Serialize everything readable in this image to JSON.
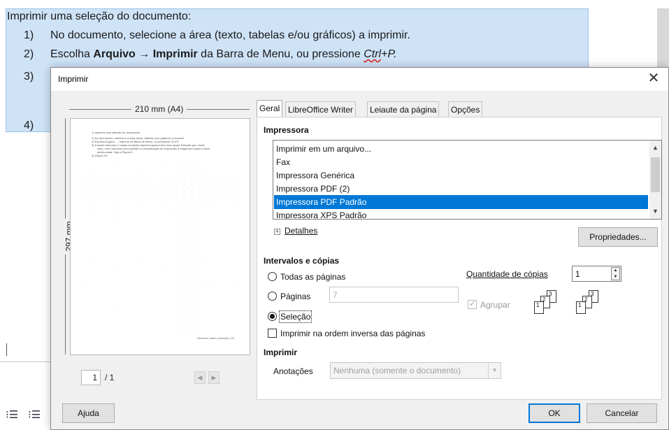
{
  "document": {
    "heading": "Imprimir uma seleção do documento:",
    "steps": [
      {
        "num": "1)",
        "text": "No documento, selecione a área (texto, tabelas e/ou gráficos) a imprimir."
      },
      {
        "num": "2)",
        "pre": "Escolha ",
        "bold1": "Arquivo",
        "arrow": " → ",
        "bold2": "Imprimir",
        "mid": " da Barra de Menu, ou pressione ",
        "italic": "Ctrl",
        "post": "+P."
      },
      {
        "num": "3)"
      },
      {
        "num": "4)"
      }
    ]
  },
  "dialog": {
    "title": "Imprimir",
    "close_glyph": "✕",
    "preview": {
      "width_label": "210 mm (A4)",
      "height_label": "297 mm",
      "current_page": "1",
      "total_pages": "/ 1",
      "prev_glyph": "◀",
      "next_glyph": "▶",
      "thumb_lines": [
        "1) Imprimir uma seleção do documento",
        "1) No documento, selecione a área (texto, tabelas e/ou gráficos) a imprimir.",
        "2) Escolha Arquivo → Imprimir da Barra de Menu, ou pressione Ctrl+P.",
        "3) A seção Intervalo e cópias da janela Imprimir agora inclui uma opção Seleção que, neste",
        "caso, vem marcada como padrão e a visualização de impressão à esquerda mostra a área",
        "selecionada. Veja a Figura 5.",
        "4) Clique OK."
      ],
      "thumb_footer": "Remover dados pessoais | 25"
    },
    "tabs": [
      {
        "label": "Geral",
        "active": true
      },
      {
        "label": "LibreOffice Writer",
        "active": false
      },
      {
        "label": "Leiaute da página",
        "active": false
      },
      {
        "label": "Opções",
        "active": false
      }
    ],
    "printer": {
      "section_label": "Impressora",
      "list": [
        "Imprimir em um arquivo...",
        "Fax",
        "Impressora Genérica",
        "Impressora PDF (2)",
        "Impressora PDF Padrão",
        "Impressora XPS Padrão"
      ],
      "selected_index": 4,
      "details_label": "Detalhes",
      "properties_button": "Propriedades..."
    },
    "ranges": {
      "section_label": "Intervalos e cópias",
      "all_pages_label": "Todas as páginas",
      "pages_label": "Páginas",
      "pages_value": "7",
      "selection_label": "Seleção",
      "selected_option": "selection",
      "reverse_label": "Imprimir na ordem inversa das páginas",
      "reverse_checked": false,
      "copies_label": "Quantidade de cópias",
      "copies_value": "1",
      "collate_label": "Agrupar",
      "collate_checked": true,
      "collate_enabled": false
    },
    "print_section": {
      "section_label": "Imprimir",
      "annotations_label": "Anotações",
      "annotations_value": "Nenhuma (somente o documento)"
    },
    "buttons": {
      "help": "Ajuda",
      "ok": "OK",
      "cancel": "Cancelar"
    }
  },
  "colors": {
    "selection_blue": "#0078d7",
    "doc_highlight": "#cfe3f7"
  }
}
